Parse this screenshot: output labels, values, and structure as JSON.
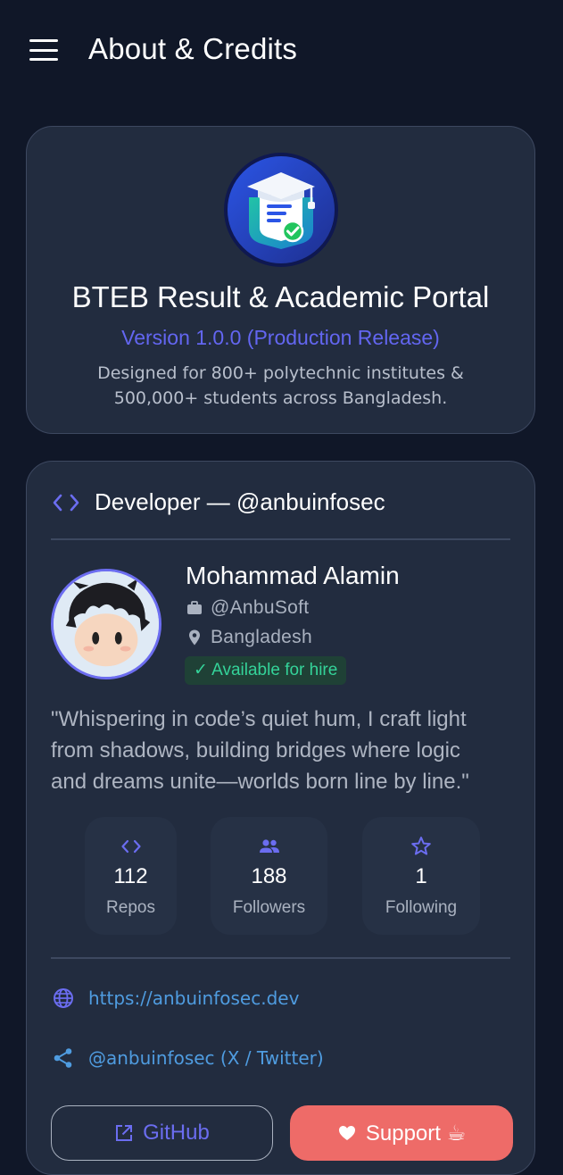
{
  "appbar": {
    "title": "About & Credits"
  },
  "app_card": {
    "name": "BTEB Result & Academic Portal",
    "version": "Version 1.0.0 (Production Release)",
    "description": "Designed for 800+ polytechnic institutes & 500,000+ students across Bangladesh."
  },
  "developer": {
    "section_title": "Developer — @anbuinfosec",
    "name": "Mohammad Alamin",
    "company": "@AnbuSoft",
    "location": "Bangladesh",
    "hire_status": "✓ Available for hire",
    "quote": "\"Whispering in code’s quiet hum, I craft light from shadows, building bridges where logic and dreams unite—worlds born line by line.\"",
    "stats": [
      {
        "value": "112",
        "label": "Repos",
        "icon": "code-icon"
      },
      {
        "value": "188",
        "label": "Followers",
        "icon": "people-icon"
      },
      {
        "value": "1",
        "label": "Following",
        "icon": "star-icon"
      }
    ],
    "website": "https://anbuinfosec.dev",
    "twitter": "@anbuinfosec (X / Twitter)",
    "github_label": "GitHub",
    "support_label": "Support ☕"
  },
  "colors": {
    "background": "#101728",
    "card": "#222c3f",
    "accent": "#6366f1",
    "link": "#4f9ce0",
    "success": "#34d399",
    "support": "#ee6b68"
  }
}
